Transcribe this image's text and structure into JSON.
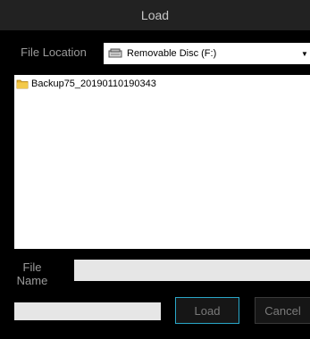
{
  "dialog": {
    "title": "Load"
  },
  "file_location": {
    "label": "File Location",
    "selected_value": "Removable Disc (F:)",
    "drive_icon": "removable-drive-icon",
    "dropdown_icon": "chevron-down-icon"
  },
  "file_list": {
    "items": [
      {
        "name": "Backup75_20190110190343",
        "icon": "folder-icon"
      }
    ]
  },
  "file_name": {
    "label": "File Name",
    "value": ""
  },
  "status": {
    "value": ""
  },
  "buttons": {
    "load_label": "Load",
    "cancel_label": "Cancel"
  },
  "colors": {
    "background": "#000000",
    "titlebar": "#222222",
    "accent_border": "#2aa7c9",
    "folder": "#e7b430"
  }
}
